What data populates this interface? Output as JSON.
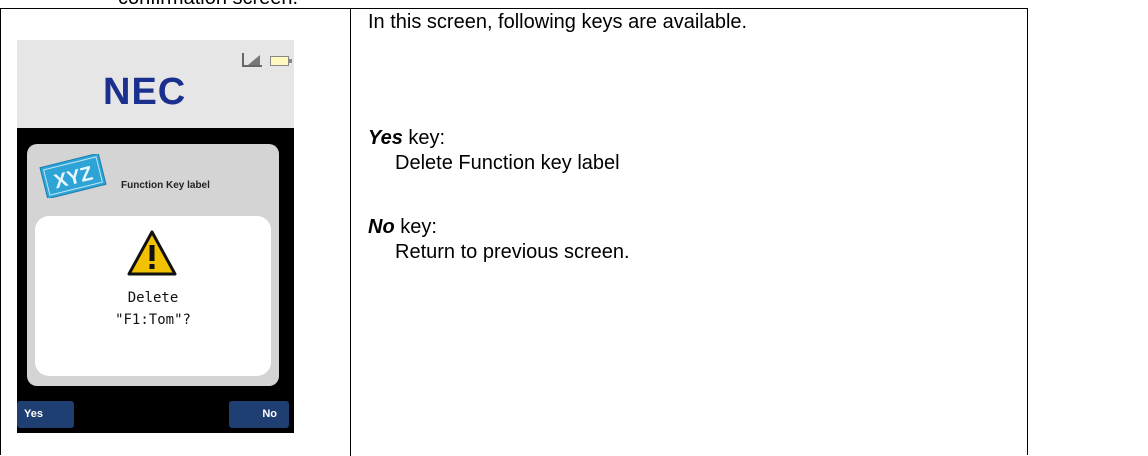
{
  "cut_text": "confirmation screen.",
  "phone": {
    "brand": "NEC",
    "signal_icon": "signal-strength-icon",
    "battery_icon": "battery-icon",
    "app_icon": "xyz-card-icon",
    "app_icon_text": "XYZ",
    "panel_title": "Function Key label",
    "warning_icon": "warning-triangle-icon",
    "dialog_line1": "Delete",
    "dialog_line2": "\"F1:Tom\"?",
    "softkey_yes": "Yes",
    "softkey_no": "No",
    "colors": {
      "brand": "#1b2f8e",
      "softkey": "#1f3f73",
      "icon_blue": "#2ea3d6",
      "warning": "#f2c200"
    }
  },
  "description": {
    "intro": "In this screen, following keys are available.",
    "keys": [
      {
        "name": "Yes",
        "suffix": " key:",
        "desc": "Delete Function key label"
      },
      {
        "name": "No",
        "suffix": " key:",
        "desc": "Return to previous screen."
      }
    ]
  }
}
